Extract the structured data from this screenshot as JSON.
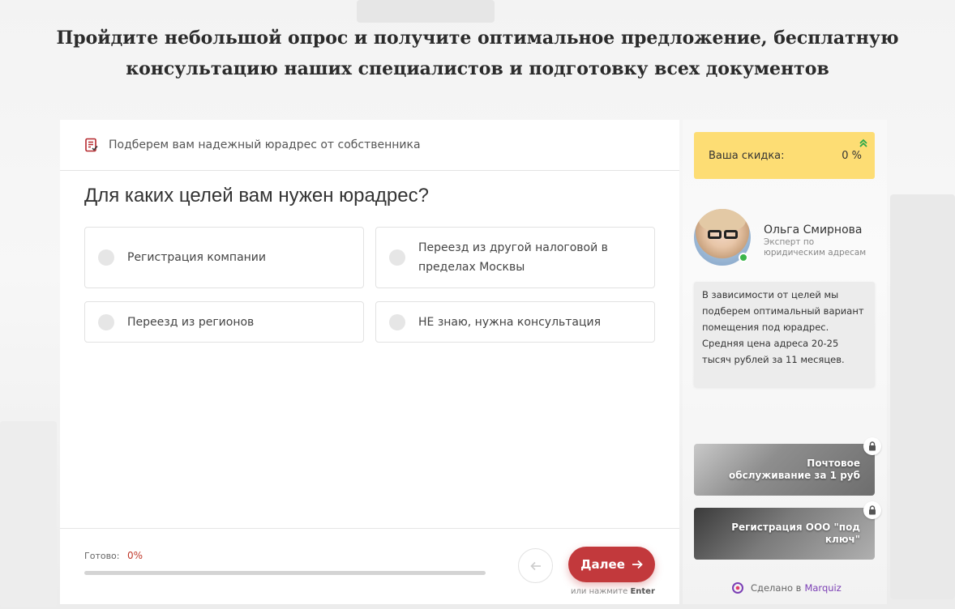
{
  "headline": {
    "line1": "Пройдите небольшой опрос и получите оптимальное предложение, бесплатную",
    "line2": "консультацию наших специалистов и подготовку  всех документов"
  },
  "quiz": {
    "subtitle": "Подберем вам надежный юрадрес от собственника",
    "question": "Для каких целей вам нужен юрадрес?",
    "options": [
      {
        "label_line1": "Регистрация компании",
        "label_line2": ""
      },
      {
        "label_line1": "Переезд из другой налоговой в",
        "label_line2": "пределах Москвы"
      },
      {
        "label_line1": "Переезд из регионов",
        "label_line2": ""
      },
      {
        "label_line1": "НЕ знаю, нужна консультация",
        "label_line2": ""
      }
    ],
    "progress_label": "Готово:",
    "progress_value": "0%",
    "progress_fraction": 0,
    "next_label": "Далее",
    "enter_hint_prefix": "или нажмите",
    "enter_hint_key": "Enter"
  },
  "sidebar": {
    "discount_label": "Ваша скидка:",
    "discount_value": "0 %",
    "expert_name": "Ольга Смирнова",
    "expert_role_line1": "Эксперт по",
    "expert_role_line2": "юридическим адресам",
    "bubble_text": "В зависимости от целей мы подберем оптимальный вариант помещения под юрадрес. Средняя цена адреса 20-25 тысяч рублей за 11 месяцев.",
    "bonuses": [
      {
        "line1": "Почтовое",
        "line2": "обслуживание за 1 руб"
      },
      {
        "line1": "Регистрация ООО \"под",
        "line2": "ключ\""
      }
    ],
    "made_by_prefix": "Сделано в",
    "made_by_brand": "Marquiz"
  },
  "icons": {
    "subtitle": "document-check-icon",
    "back": "arrow-left-icon",
    "next": "arrow-right-icon",
    "discount": "double-chevron-up-icon",
    "bonus": "lock-icon",
    "brand": "marquiz-logo-icon"
  },
  "colors": {
    "accent_red": "#c2393c",
    "discount_yellow": "#fddd74",
    "online_green": "#3cb54a",
    "brand_purple": "#7b3fb5"
  }
}
